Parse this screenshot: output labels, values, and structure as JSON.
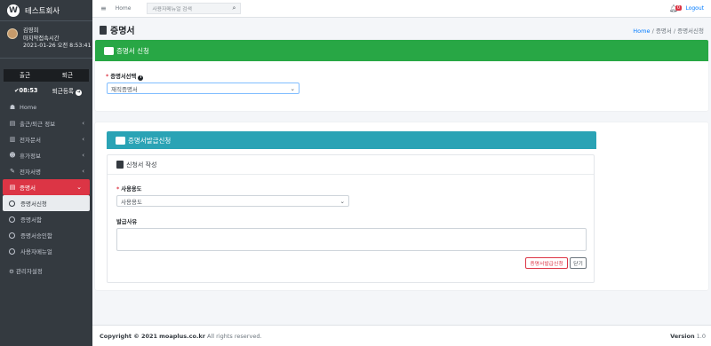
{
  "app": {
    "logo_letter": "W",
    "company": "테스트회사"
  },
  "user": {
    "name": "김영희",
    "last_label": "마지막접속시간",
    "last_time": "2021-01-26 오전 8:53:41"
  },
  "attendance": {
    "in_label": "출근",
    "out_label": "퇴근",
    "time": "✔08:53",
    "out_reg_label": "퇴근등록"
  },
  "nav": [
    {
      "icon": "☗",
      "label": "Home"
    },
    {
      "icon": "▤",
      "label": "출근/퇴근 정보"
    },
    {
      "icon": "▥",
      "label": "전자문서"
    },
    {
      "icon": "☻",
      "label": "휴가정보"
    },
    {
      "icon": "✎",
      "label": "전자서명"
    },
    {
      "icon": "▤",
      "label": "증명서"
    }
  ],
  "nav_sub": [
    "증명서신청",
    "증명서함",
    "증명서승인함",
    "사용자메뉴얼"
  ],
  "admin_label": "관리자설정",
  "topbar": {
    "home": "Home",
    "search_placeholder": "사용자메뉴얼 검색",
    "notif_count": "0",
    "logout": "Logout"
  },
  "page": {
    "title": "증명서",
    "crumb_home": "Home",
    "crumb_rest": "/  증명서 / 증명서신청"
  },
  "card1": {
    "title": "증명서 신청",
    "select_label": "증명서선택",
    "select_value": "재직증명서"
  },
  "card2": {
    "title": "증명서발급신청",
    "sub_title": "신청서 작성",
    "purpose_label": "사용용도",
    "purpose_value": "사용용도",
    "reason_label": "발급사유",
    "submit_label": "증명서발급신청",
    "close_label": "닫기"
  },
  "footer": {
    "copyright": "Copyright © 2021",
    "domain": "moaplus.co.kr",
    "rights": "All rights reserved.",
    "version_label": "Version",
    "version": "1.0"
  }
}
